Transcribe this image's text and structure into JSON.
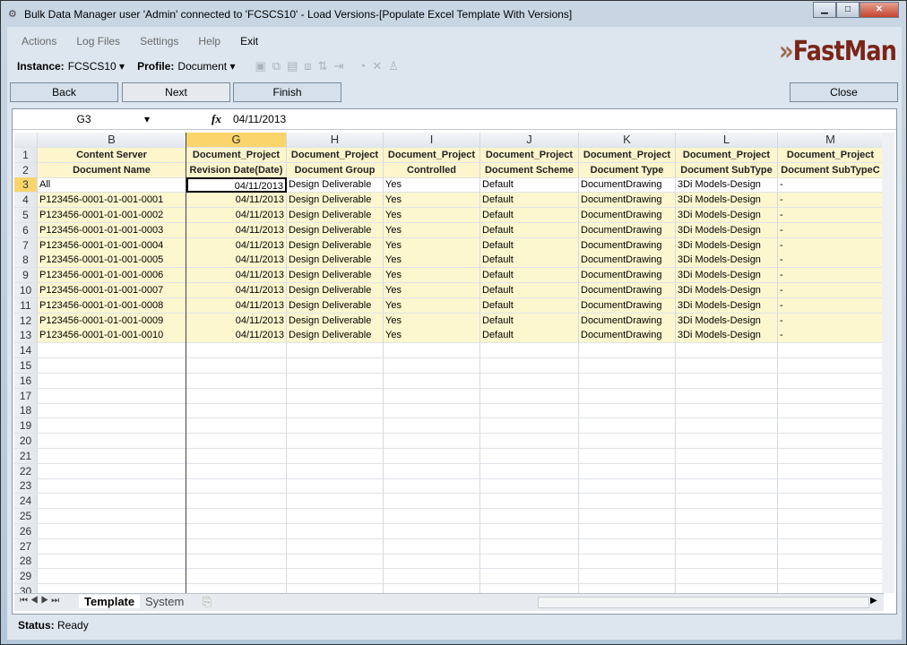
{
  "window": {
    "title": "Bulk Data Manager user 'Admin' connected to 'FCSCS10' - Load Versions-[Populate Excel Template With Versions]",
    "minimize": "▁",
    "maximize": "□",
    "close": "✕"
  },
  "menu": [
    "Actions",
    "Log Files",
    "Settings",
    "Help",
    "Exit"
  ],
  "logo": {
    "text": "FastMan",
    "chevrons": "»"
  },
  "toolbar": {
    "instance_label": "Instance:",
    "instance_value": "FCSCS10",
    "profile_label": "Profile:",
    "profile_value": "Document"
  },
  "buttons": {
    "back": "Back",
    "next": "Next",
    "finish": "Finish",
    "close": "Close"
  },
  "formula": {
    "cell": "G3",
    "fx": "fx",
    "value": "04/11/2013"
  },
  "columns": [
    "B",
    "G",
    "H",
    "I",
    "J",
    "K",
    "L",
    "M"
  ],
  "header_row1": [
    "Content Server",
    "Document_Project",
    "Document_Project",
    "Document_Project",
    "Document_Project",
    "Document_Project",
    "Document_Project",
    "Document_Project"
  ],
  "header_row2": [
    "Document Name",
    "Revision Date(Date)",
    "Document Group",
    "Controlled",
    "Document Scheme",
    "Document Type",
    "Document SubType",
    "Document SubTypeC"
  ],
  "rows": [
    [
      "All",
      "04/11/2013",
      "Design Deliverable",
      "Yes",
      "Default",
      "DocumentDrawing",
      "3Di Models-Design",
      "-"
    ],
    [
      "P123456-0001-01-001-0001",
      "04/11/2013",
      "Design Deliverable",
      "Yes",
      "Default",
      "DocumentDrawing",
      "3Di Models-Design",
      "-"
    ],
    [
      "P123456-0001-01-001-0002",
      "04/11/2013",
      "Design Deliverable",
      "Yes",
      "Default",
      "DocumentDrawing",
      "3Di Models-Design",
      "-"
    ],
    [
      "P123456-0001-01-001-0003",
      "04/11/2013",
      "Design Deliverable",
      "Yes",
      "Default",
      "DocumentDrawing",
      "3Di Models-Design",
      "-"
    ],
    [
      "P123456-0001-01-001-0004",
      "04/11/2013",
      "Design Deliverable",
      "Yes",
      "Default",
      "DocumentDrawing",
      "3Di Models-Design",
      "-"
    ],
    [
      "P123456-0001-01-001-0005",
      "04/11/2013",
      "Design Deliverable",
      "Yes",
      "Default",
      "DocumentDrawing",
      "3Di Models-Design",
      "-"
    ],
    [
      "P123456-0001-01-001-0006",
      "04/11/2013",
      "Design Deliverable",
      "Yes",
      "Default",
      "DocumentDrawing",
      "3Di Models-Design",
      "-"
    ],
    [
      "P123456-0001-01-001-0007",
      "04/11/2013",
      "Design Deliverable",
      "Yes",
      "Default",
      "DocumentDrawing",
      "3Di Models-Design",
      "-"
    ],
    [
      "P123456-0001-01-001-0008",
      "04/11/2013",
      "Design Deliverable",
      "Yes",
      "Default",
      "DocumentDrawing",
      "3Di Models-Design",
      "-"
    ],
    [
      "P123456-0001-01-001-0009",
      "04/11/2013",
      "Design Deliverable",
      "Yes",
      "Default",
      "DocumentDrawing",
      "3Di Models-Design",
      "-"
    ],
    [
      "P123456-0001-01-001-0010",
      "04/11/2013",
      "Design Deliverable",
      "Yes",
      "Default",
      "DocumentDrawing",
      "3Di Models-Design",
      "-"
    ]
  ],
  "row_count": 30,
  "selected": {
    "row": 3,
    "column": "G"
  },
  "sheet_tabs": [
    "Template",
    "System"
  ],
  "active_tab": "Template",
  "status": {
    "label": "Status:",
    "value": "Ready"
  }
}
